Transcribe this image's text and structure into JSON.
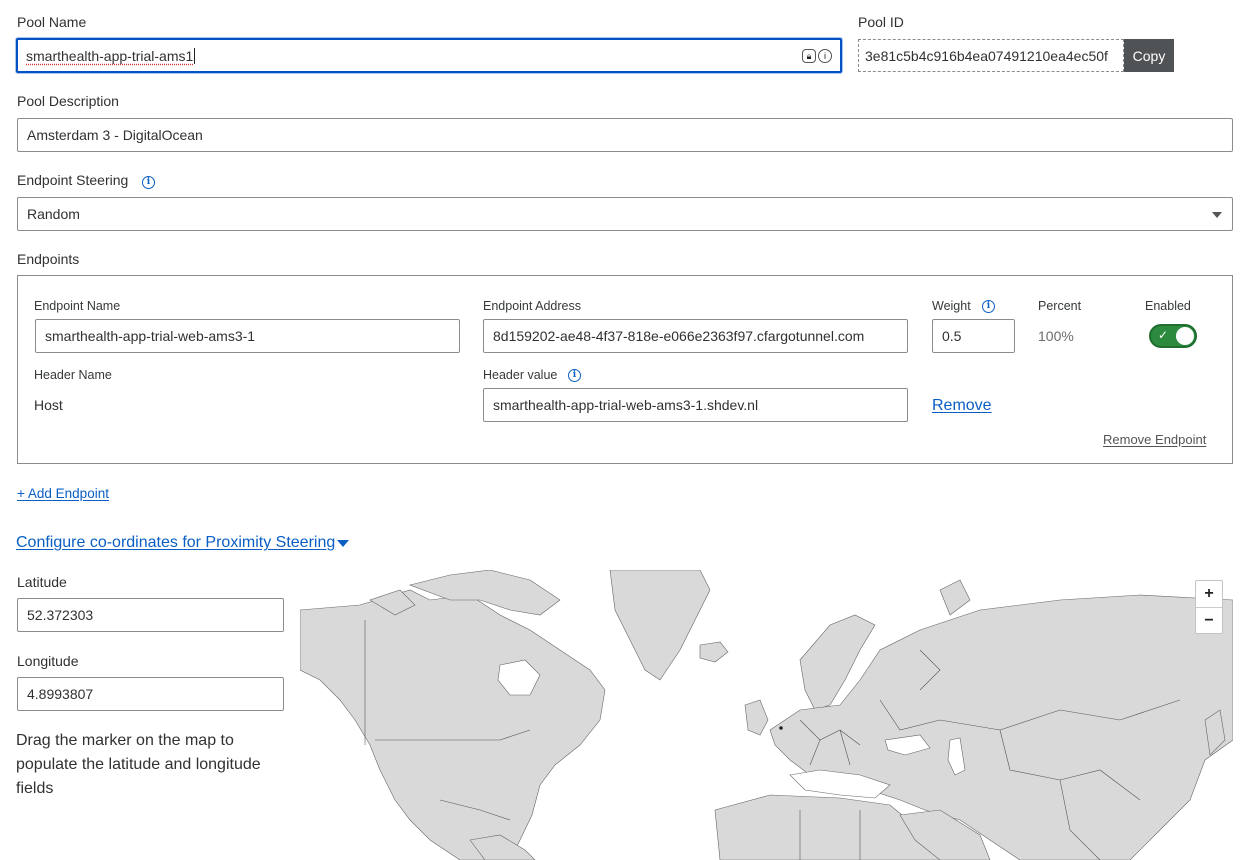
{
  "pool_name": {
    "label": "Pool Name",
    "value": "smarthealth-app-trial-ams1"
  },
  "pool_id": {
    "label": "Pool ID",
    "value": "3e81c5b4c916b4ea07491210ea4ec50f",
    "copy_label": "Copy"
  },
  "pool_description": {
    "label": "Pool Description",
    "value": "Amsterdam 3 - DigitalOcean"
  },
  "endpoint_steering": {
    "label": "Endpoint Steering",
    "value": "Random"
  },
  "endpoints": {
    "label": "Endpoints",
    "endpoint_name_label": "Endpoint Name",
    "endpoint_name_value": "smarthealth-app-trial-web-ams3-1",
    "endpoint_address_label": "Endpoint Address",
    "endpoint_address_value": "8d159202-ae48-4f37-818e-e066e2363f97.cfargotunnel.com",
    "weight_label": "Weight",
    "weight_value": "0.5",
    "percent_label": "Percent",
    "percent_value": "100%",
    "enabled_label": "Enabled",
    "enabled": true,
    "header_name_label": "Header Name",
    "header_name_value": "Host",
    "header_value_label": "Header value",
    "header_value_value": "smarthealth-app-trial-web-ams3-1.shdev.nl",
    "remove_label": "Remove",
    "remove_endpoint_label": "Remove Endpoint",
    "add_endpoint_label": "+ Add Endpoint"
  },
  "proximity": {
    "toggle_label": "Configure co-ordinates for Proximity Steering",
    "latitude_label": "Latitude",
    "latitude_value": "52.372303",
    "longitude_label": "Longitude",
    "longitude_value": "4.8993807",
    "hint": "Drag the marker on the map to populate the latitude and longitude fields"
  },
  "map": {
    "zoom_in": "+",
    "zoom_out": "−",
    "land_color": "#d9d9d9",
    "border_color": "#666666"
  }
}
